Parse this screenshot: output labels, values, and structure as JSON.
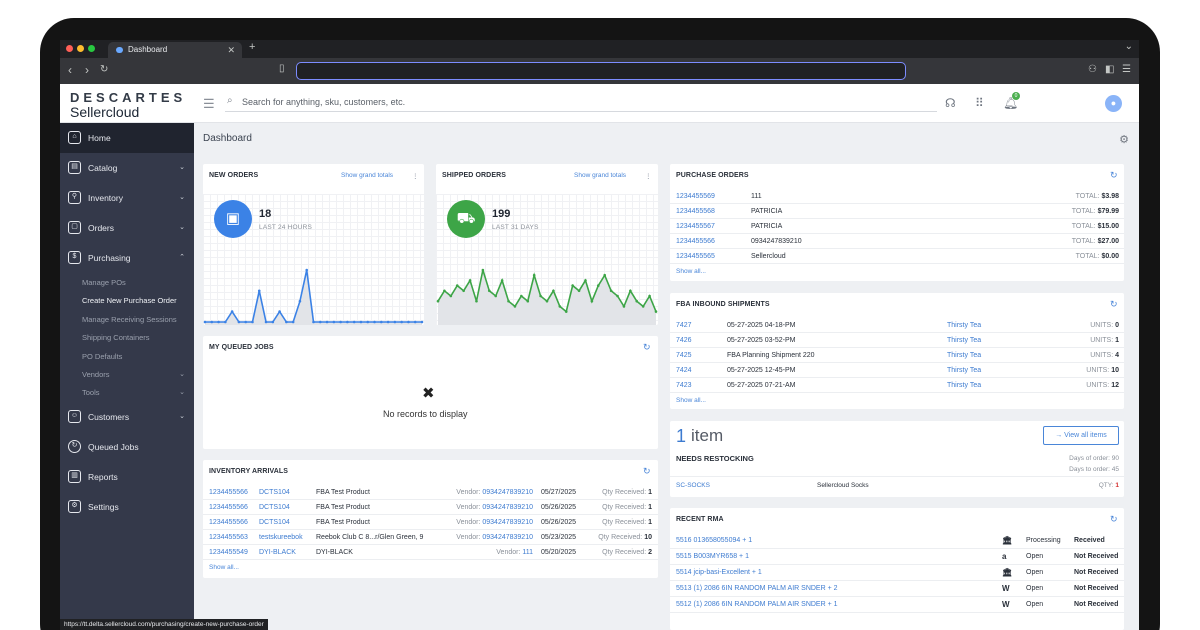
{
  "browser": {
    "tab_title": "Dashboard",
    "tab_close": "✕",
    "new_tab": "+",
    "status_url": "https://tt.delta.sellercloud.com/purchasing/create-new-purchase-order"
  },
  "app": {
    "logo_top": "DESCARTES",
    "logo_bottom": "Sellercloud",
    "search_placeholder": "Search for anything, sku, customers, etc.",
    "notification_count": "0",
    "page_title": "Dashboard"
  },
  "sidebar": {
    "items": [
      {
        "label": "Home",
        "icon": "home-icon"
      },
      {
        "label": "Catalog",
        "icon": "catalog-icon"
      },
      {
        "label": "Inventory",
        "icon": "inventory-icon"
      },
      {
        "label": "Orders",
        "icon": "orders-icon"
      },
      {
        "label": "Purchasing",
        "icon": "purchasing-icon"
      },
      {
        "label": "Customers",
        "icon": "customers-icon"
      },
      {
        "label": "Queued Jobs",
        "icon": "queued-jobs-icon"
      },
      {
        "label": "Reports",
        "icon": "reports-icon"
      },
      {
        "label": "Settings",
        "icon": "settings-icon"
      }
    ],
    "purchasing_sub": [
      "Manage POs",
      "Create New Purchase Order",
      "Manage Receiving Sessions",
      "Shipping Containers",
      "PO Defaults",
      "Vendors",
      "Tools"
    ]
  },
  "new_orders": {
    "title": "NEW ORDERS",
    "link": "Show grand totals",
    "count": "18",
    "period": "LAST 24 HOURS",
    "color": "#3b82e6",
    "series": [
      0,
      0,
      0,
      0,
      1,
      0,
      0,
      0,
      3,
      0,
      0,
      1,
      0,
      0,
      2,
      5,
      0,
      0,
      0,
      0,
      0,
      0,
      0,
      0,
      0,
      0,
      0,
      0,
      0,
      0,
      0,
      0,
      0
    ]
  },
  "shipped_orders": {
    "title": "SHIPPED ORDERS",
    "link": "Show grand totals",
    "count": "199",
    "period": "LAST 31 DAYS",
    "color": "#3da547",
    "series": [
      4,
      6,
      5,
      7,
      6,
      8,
      4,
      10,
      6,
      5,
      8,
      4,
      3,
      5,
      4,
      9,
      5,
      4,
      6,
      3,
      2,
      7,
      6,
      8,
      4,
      7,
      9,
      6,
      5,
      3,
      6,
      4,
      3,
      5,
      2
    ]
  },
  "queued_jobs": {
    "title": "MY QUEUED JOBS",
    "empty": "No records to display"
  },
  "inventory_arrivals": {
    "title": "INVENTORY ARRIVALS",
    "vendor_label": "Vendor:",
    "qty_label": "Qty Received:",
    "show_all": "Show all...",
    "rows": [
      {
        "po": "1234455566",
        "sku": "DCTS104",
        "name": "FBA Test Product",
        "vendor": "0934247839210",
        "date": "05/27/2025",
        "qty": "1"
      },
      {
        "po": "1234455566",
        "sku": "DCTS104",
        "name": "FBA Test Product",
        "vendor": "0934247839210",
        "date": "05/26/2025",
        "qty": "1"
      },
      {
        "po": "1234455566",
        "sku": "DCTS104",
        "name": "FBA Test Product",
        "vendor": "0934247839210",
        "date": "05/26/2025",
        "qty": "1"
      },
      {
        "po": "1234455563",
        "sku": "testskureebok",
        "name": "Reebok Club C 8...r/Glen Green, 9",
        "vendor": "0934247839210",
        "date": "05/23/2025",
        "qty": "10"
      },
      {
        "po": "1234455549",
        "sku": "DYI-BLACK",
        "name": "DYI-BLACK",
        "vendor": "111",
        "date": "05/20/2025",
        "qty": "2"
      }
    ]
  },
  "purchase_orders": {
    "title": "PURCHASE ORDERS",
    "total_label": "TOTAL:",
    "show_all": "Show all...",
    "rows": [
      {
        "id": "1234455569",
        "vendor": "111",
        "total": "$3.98"
      },
      {
        "id": "1234455568",
        "vendor": "PATRICIA",
        "total": "$79.99"
      },
      {
        "id": "1234455567",
        "vendor": "PATRICIA",
        "total": "$15.00"
      },
      {
        "id": "1234455566",
        "vendor": "0934247839210",
        "total": "$27.00"
      },
      {
        "id": "1234455565",
        "vendor": "Sellercloud",
        "total": "$0.00"
      }
    ]
  },
  "fba_inbound": {
    "title": "FBA INBOUND SHIPMENTS",
    "units_label": "UNITS:",
    "show_all": "Show all...",
    "rows": [
      {
        "id": "7427",
        "name": "05-27-2025 04-18-PM",
        "company": "Thirsty Tea",
        "units": "0"
      },
      {
        "id": "7426",
        "name": "05-27-2025 03-52-PM",
        "company": "Thirsty Tea",
        "units": "1"
      },
      {
        "id": "7425",
        "name": "FBA Planning Shipment 220",
        "company": "Thirsty Tea",
        "units": "4"
      },
      {
        "id": "7424",
        "name": "05-27-2025 12-45-PM",
        "company": "Thirsty Tea",
        "units": "10"
      },
      {
        "id": "7423",
        "name": "05-27-2025 07-21-AM",
        "company": "Thirsty Tea",
        "units": "12"
      }
    ]
  },
  "restocking": {
    "count": "1",
    "unit": "item",
    "subtitle": "NEEDS RESTOCKING",
    "button": "View all items",
    "days_of_order": "Days of order: 90",
    "days_to_order": "Days to order: 45",
    "sku": "SC-SOCKS",
    "name": "Sellercloud Socks",
    "qty_label": "QTY:",
    "qty": "1"
  },
  "recent_rma": {
    "title": "RECENT RMA",
    "rows": [
      {
        "id": "5516",
        "ref": "013658055094 + 1",
        "channel": "storefront-icon",
        "status": "Processing",
        "received": "Received"
      },
      {
        "id": "5515",
        "ref": "B003MYR658 + 1",
        "channel": "amazon-icon",
        "status": "Open",
        "received": "Not Received"
      },
      {
        "id": "5514",
        "ref": "jcip-basi-Excellent + 1",
        "channel": "storefront-icon",
        "status": "Open",
        "received": "Not Received"
      },
      {
        "id": "5513",
        "ref": "(1) 2086 6IN RANDOM PALM AIR SNDER + 2",
        "channel": "walmart-icon",
        "status": "Open",
        "received": "Not Received"
      },
      {
        "id": "5512",
        "ref": "(1) 2086 6IN RANDOM PALM AIR SNDER + 1",
        "channel": "walmart-icon",
        "status": "Open",
        "received": "Not Received"
      }
    ]
  }
}
